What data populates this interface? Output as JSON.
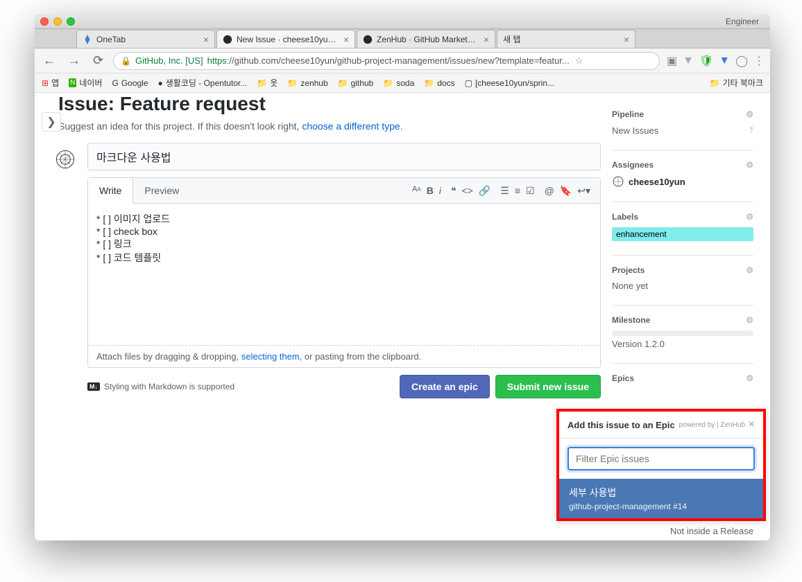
{
  "titlebar": {
    "right_label": "Engineer"
  },
  "tabs": [
    {
      "title": "OneTab",
      "icon": "onetab"
    },
    {
      "title": "New Issue · cheese10yun/gi",
      "icon": "github",
      "active": true
    },
    {
      "title": "ZenHub · GitHub Marketplac",
      "icon": "github"
    },
    {
      "title": "새 탭",
      "icon": "blank"
    }
  ],
  "url": {
    "company": "GitHub, Inc. [US]",
    "protocol": "https",
    "rest": "://github.com/cheese10yun/github-project-management/issues/new?template=featur..."
  },
  "bookmarks": {
    "apps": "앱",
    "items": [
      "네이버",
      "Google",
      "생활코딩 - Opentutor...",
      "옷",
      "zenhub",
      "github",
      "soda",
      "docs",
      "[cheese10yun/sprin..."
    ],
    "right": "기타 북마크"
  },
  "issue": {
    "heading": "Issue: Feature request",
    "subtitle_pre": "Suggest an idea for this project. If this doesn't look right, ",
    "subtitle_link": "choose a different type",
    "title_value": "마크다운 사용법",
    "write_tab": "Write",
    "preview_tab": "Preview",
    "body": "* [ ] 이미지 업로드\n* [ ] check box\n* [ ] 링크\n* [ ] 코드 템플릿",
    "attach_pre": "Attach files by dragging & dropping, ",
    "attach_link": "selecting them",
    "attach_post": ", or pasting from the clipboard.",
    "md_hint": "Styling with Markdown is supported",
    "btn_epic": "Create an epic",
    "btn_submit": "Submit new issue"
  },
  "sidebar": {
    "pipeline": {
      "label": "Pipeline",
      "value": "New Issues"
    },
    "assignees": {
      "label": "Assignees",
      "value": "cheese10yun"
    },
    "labels": {
      "label": "Labels",
      "value": "enhancement"
    },
    "projects": {
      "label": "Projects",
      "value": "None yet"
    },
    "milestone": {
      "label": "Milestone",
      "value": "Version 1.2.0"
    },
    "epics": {
      "label": "Epics"
    }
  },
  "epic_popover": {
    "title": "Add this issue to an Epic",
    "powered": "powered by | ZenHub",
    "filter_placeholder": "Filter Epic issues",
    "item_title": "세부 사용법",
    "item_sub": "github-project-management #14"
  },
  "release_note": "Not inside a Release"
}
